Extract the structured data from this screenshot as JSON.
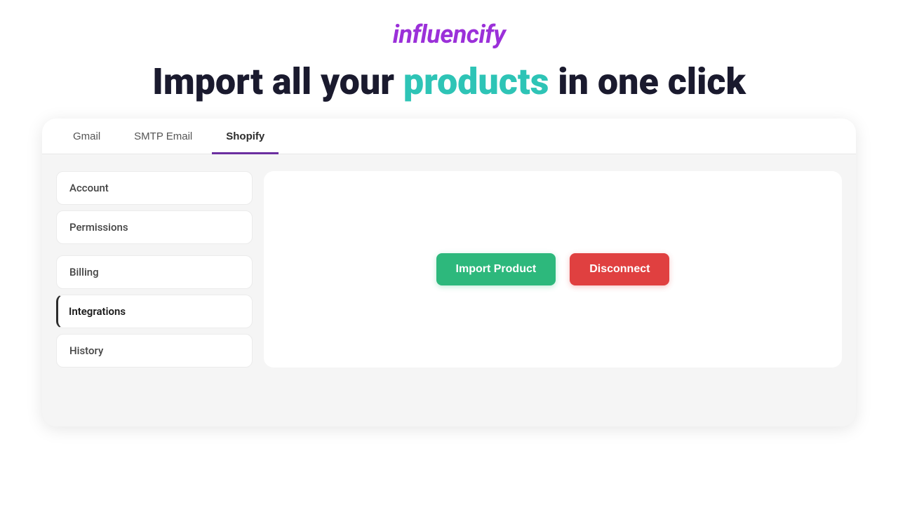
{
  "header": {
    "logo": "influencify",
    "headline_part1": "Import all your ",
    "headline_highlight": "products",
    "headline_part2": " in one click"
  },
  "tabs": [
    {
      "id": "gmail",
      "label": "Gmail",
      "active": false
    },
    {
      "id": "smtp-email",
      "label": "SMTP Email",
      "active": false
    },
    {
      "id": "shopify",
      "label": "Shopify",
      "active": true
    }
  ],
  "sidebar": {
    "items": [
      {
        "id": "account",
        "label": "Account",
        "active": false
      },
      {
        "id": "permissions",
        "label": "Permissions",
        "active": false
      },
      {
        "id": "billing",
        "label": "Billing",
        "active": false
      },
      {
        "id": "integrations",
        "label": "Integrations",
        "active": true
      },
      {
        "id": "history",
        "label": "History",
        "active": false
      }
    ]
  },
  "main": {
    "import_button_label": "Import Product",
    "disconnect_button_label": "Disconnect"
  },
  "colors": {
    "logo": "#9b30d9",
    "headline_highlight": "#2ec4b6",
    "active_tab_border": "#6b2fa0",
    "import_btn": "#2db87c",
    "disconnect_btn": "#e04040"
  }
}
